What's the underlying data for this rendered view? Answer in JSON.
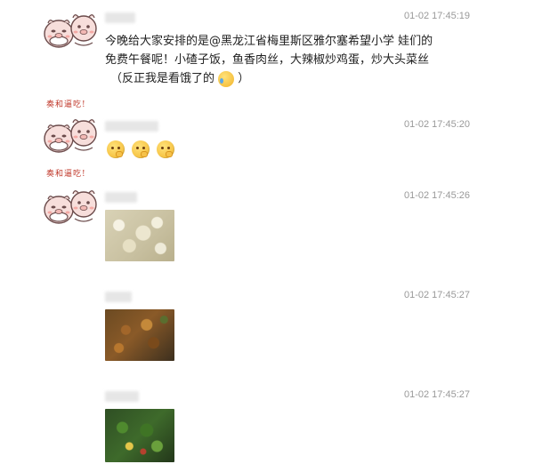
{
  "avatar_caption": "奏和逼吃!",
  "messages": [
    {
      "time": "01-02 17:45:19",
      "text_lines": [
        "今晚给大家安排的是@黑龙江省梅里斯区雅尔塞希望小学 娃们的",
        "免费午餐呢！小碴子饭，鱼香肉丝，大辣椒炒鸡蛋，炒大头菜丝",
        "（反正我是看饿了的"
      ],
      "text_suffix": "）",
      "inline_emoji": "laugh-cry-icon"
    },
    {
      "time": "01-02 17:45:20",
      "emoji": [
        "thinking-icon",
        "thinking-icon",
        "thinking-icon"
      ]
    },
    {
      "time": "01-02 17:45:26",
      "photo": "rice-photo"
    },
    {
      "time": "01-02 17:45:27",
      "photo": "shredded-pork-photo"
    },
    {
      "time": "01-02 17:45:27",
      "photo": "stir-fried-greens-photo"
    }
  ]
}
